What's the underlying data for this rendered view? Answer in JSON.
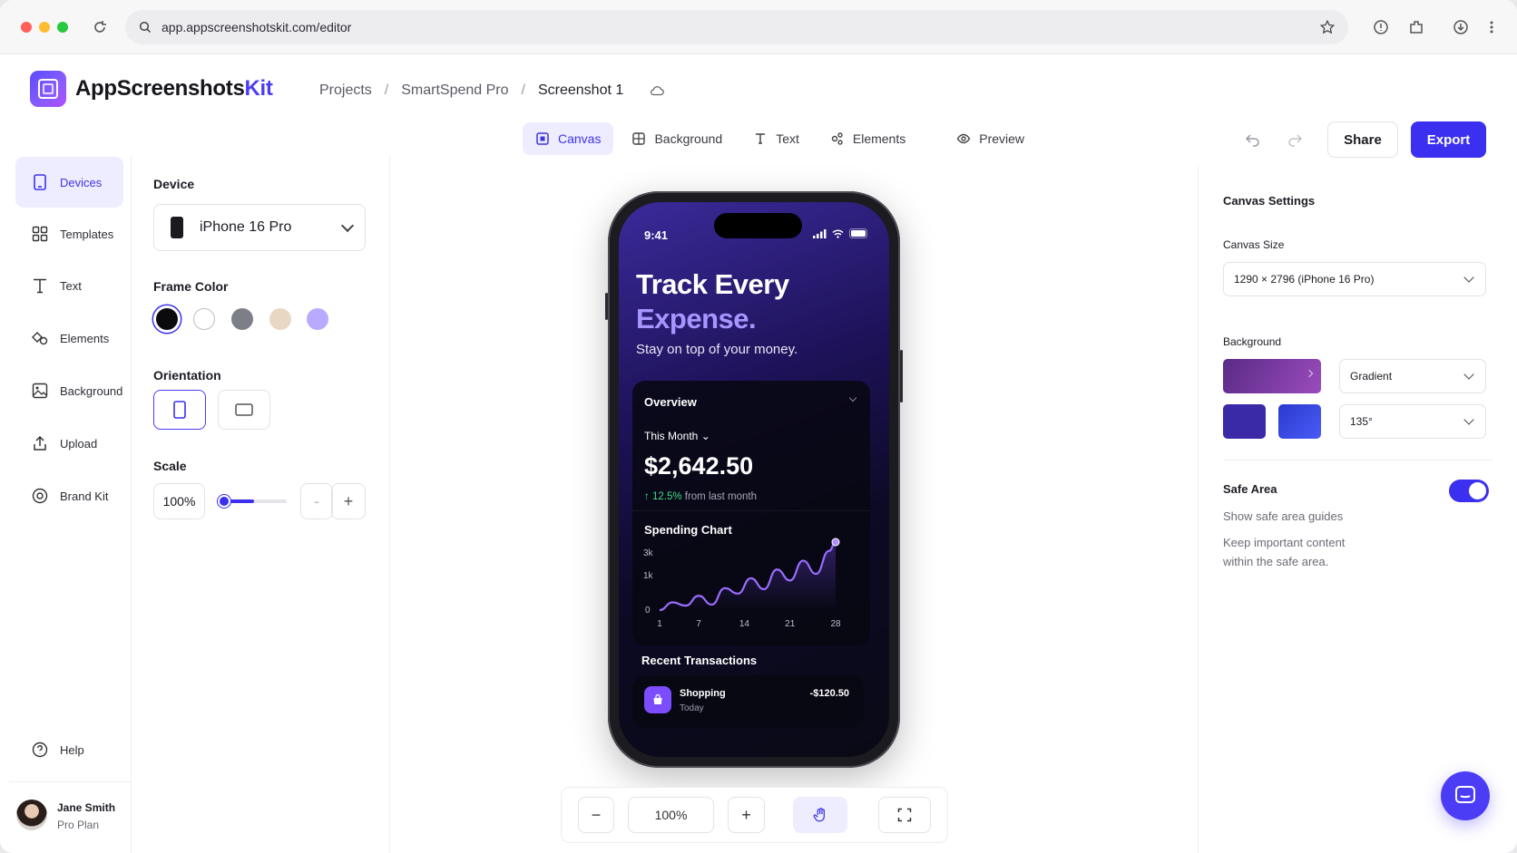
{
  "browser": {
    "url": "app.appscreenshotskit.com/editor",
    "icons": [
      "reload-icon",
      "search-icon",
      "star-icon",
      "shield-icon",
      "extensions-icon",
      "download-icon",
      "menu-dots-icon"
    ]
  },
  "header": {
    "brand_main": "AppScreenshots",
    "brand_accent": "Kit",
    "breadcrumb": [
      "Projects",
      "SmartSpend Pro",
      "Screenshot 1"
    ],
    "share_label": "Share",
    "export_label": "Export"
  },
  "tabs": [
    {
      "label": "Canvas",
      "active": true
    },
    {
      "label": "Background",
      "active": false
    },
    {
      "label": "Text",
      "active": false
    },
    {
      "label": "Elements",
      "active": false
    },
    {
      "label": "Preview",
      "active": false
    }
  ],
  "sidebar": {
    "items": [
      {
        "label": "Devices",
        "active": true
      },
      {
        "label": "Templates",
        "active": false
      },
      {
        "label": "Text",
        "active": false
      },
      {
        "label": "Elements",
        "active": false
      },
      {
        "label": "Background",
        "active": false
      },
      {
        "label": "Upload",
        "active": false
      },
      {
        "label": "Brand Kit",
        "active": false
      }
    ],
    "help_label": "Help",
    "user": {
      "name": "Jane Smith",
      "plan": "Pro Plan"
    }
  },
  "left_panel": {
    "device_label": "Device",
    "device_value": "iPhone 16 Pro",
    "frame_color_label": "Frame Color",
    "frame_colors": [
      "#0b0b0e",
      "#ffffff",
      "#7d7f86",
      "#e8d8c3",
      "#b9aaff"
    ],
    "selected_frame_color": 0,
    "orientation_label": "Orientation",
    "orientation_selected": "portrait",
    "scale_label": "Scale",
    "scale_value": "100%",
    "scale_minus": "-",
    "scale_plus": "+"
  },
  "phone": {
    "time": "9:41",
    "headline_1": "Track Every",
    "headline_2": "Expense.",
    "subtitle": "Stay on top of your money.",
    "overview_title": "Overview",
    "period": "This Month",
    "amount": "$2,642.50",
    "delta_value": "12.5%",
    "delta_text": "from last month",
    "chart_title": "Spending Chart",
    "chart_y_labels": [
      "3k",
      "1k",
      "0"
    ],
    "chart_x_labels": [
      "1",
      "7",
      "14",
      "21",
      "28"
    ],
    "recent_title": "Recent Transactions",
    "transaction": {
      "name": "Shopping",
      "date": "Today",
      "amount": "-$120.50"
    }
  },
  "chart_data": {
    "type": "line",
    "title": "Spending Chart",
    "x": [
      1,
      3,
      5,
      7,
      9,
      11,
      13,
      15,
      17,
      19,
      21,
      23,
      25,
      27,
      28
    ],
    "y": [
      0,
      350,
      200,
      650,
      250,
      1000,
      750,
      1450,
      950,
      1850,
      1350,
      2250,
      1650,
      2700,
      3100
    ],
    "x_ticks": [
      "1",
      "7",
      "14",
      "21",
      "28"
    ],
    "y_ticks": [
      "0",
      "1k",
      "3k"
    ],
    "grid": false
  },
  "right_panel": {
    "title": "Canvas Settings",
    "canvas_size_label": "Canvas Size",
    "canvas_size_value": "1290 × 2796 (iPhone 16 Pro)",
    "background_label": "Background",
    "background_type": "Gradient",
    "gradient_angle": "135°",
    "gradient_colors": [
      "#3a2aa8",
      "#3a4df0"
    ],
    "safe_area_label": "Safe Area",
    "safe_area_on": true,
    "safe_area_hint": "Show safe area guides",
    "safe_area_note": "Keep important content within the safe area."
  },
  "zoom": {
    "minus": "−",
    "value": "100%",
    "plus": "+"
  }
}
